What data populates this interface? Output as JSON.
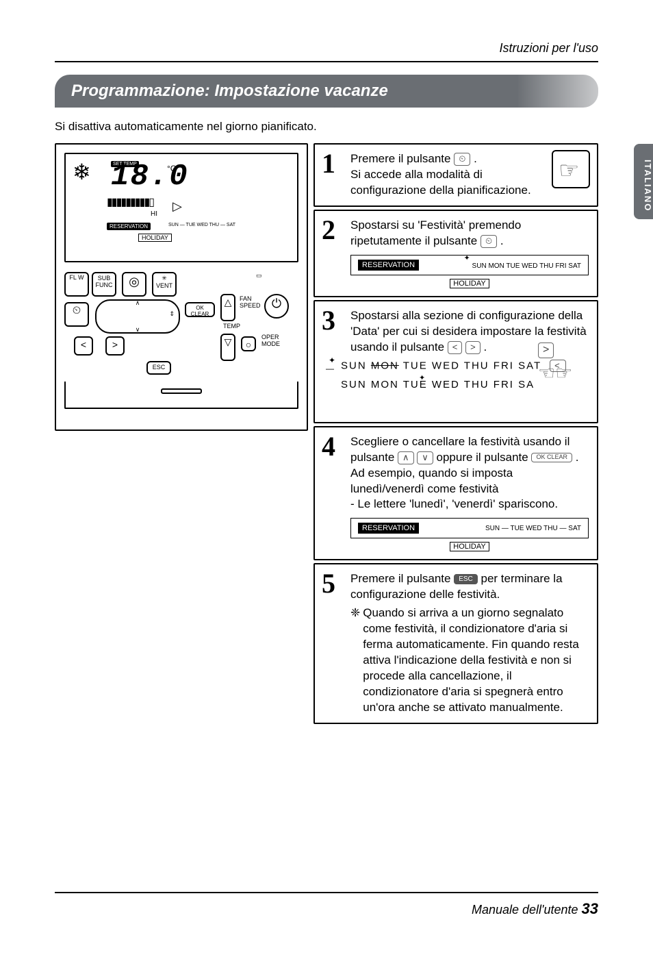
{
  "header": {
    "right": "Istruzioni per l'uso"
  },
  "title": "Programmazione: Impostazione vacanze",
  "intro": "Si disattiva automaticamente nel giorno pianificato.",
  "side_tab": "ITALIANO",
  "lcd": {
    "snow_icon": "❄",
    "settemp": "SET TEMP",
    "digits": "18.0",
    "degc": "°C",
    "bars": "▮▮▮▮▮▮▮▮▮▯",
    "hi": "HI",
    "arrow": "▷",
    "reservation": "RESERVATION",
    "days_mini": "SUN — TUE WED THU — SAT",
    "holiday": "HOLIDAY"
  },
  "remote": {
    "flw": "FL W",
    "sub_func": "SUB\nFUNC",
    "o": "◎",
    "vent": "✳\nVENT",
    "clock": "⏲",
    "up": "∧",
    "down": "∨",
    "left": "<",
    "right": ">",
    "updown": "⇕",
    "ok_clear": "OK\nCLEAR",
    "fan_speed": "FAN\nSPEED",
    "temp": "TEMP",
    "tri_up": "△",
    "tri_down": "▽",
    "circle": "○",
    "power": "⏻",
    "oper_mode": "OPER\nMODE",
    "box": "▭",
    "esc": "ESC"
  },
  "steps": {
    "s1": {
      "num": "1",
      "t1": "Premere il pulsante ",
      "btn": "⏲",
      "t2": " .",
      "t3": "Si accede alla modalità di configurazione della pianificazione."
    },
    "s2": {
      "num": "2",
      "t1": "Spostarsi su 'Festività' premendo ripetutamente il pulsante ",
      "btn": "⏲",
      "t2": ".",
      "reservation": "RESERVATION",
      "days": "SUN MON TUE WED THU FRI SAT",
      "holiday": "HOLIDAY"
    },
    "s3": {
      "num": "3",
      "t1": "Spostarsi alla sezione di configurazione della 'Data' per cui si desidera impostare la festività usando il pulsante ",
      "btn_l": "<",
      "btn_r": ">",
      "t2": " .",
      "line1_pre": "SUN ",
      "line1_strike": "MON",
      "line1_post": " TUE WED THU  FRI  SAT",
      "line2_pre": "SUN MON TUE WED THU  FRI  SA",
      "hands": "☜ ☞"
    },
    "s4": {
      "num": "4",
      "t1": "Scegliere o cancellare la festività usando il pulsante ",
      "btn_up": "∧",
      "btn_dn": "∨",
      "t2": " oppure il pulsante ",
      "btn_ok": "OK CLEAR",
      "t3": " .",
      "t4": "Ad esempio, quando si imposta lunedì/venerdì come festività",
      "t5": "- Le lettere 'lunedì', 'venerdì' spariscono.",
      "reservation": "RESERVATION",
      "days": "SUN — TUE WED THU — SAT",
      "holiday": "HOLIDAY"
    },
    "s5": {
      "num": "5",
      "t1": "Premere il pulsante ",
      "btn": "ESC",
      "t2": " per terminare la configurazione delle festività.",
      "note_bullet": "❈",
      "note": " Quando si arriva a un giorno segnalato come festività, il condizionatore d'aria si ferma automaticamente. Fin quando resta attiva l'indicazione della festività e non si procede alla cancellazione, il condizionatore d'aria si spegnerà entro un'ora anche se attivato manualmente."
    }
  },
  "footer": {
    "text": "Manuale dell'utente ",
    "pagenum": "33"
  }
}
